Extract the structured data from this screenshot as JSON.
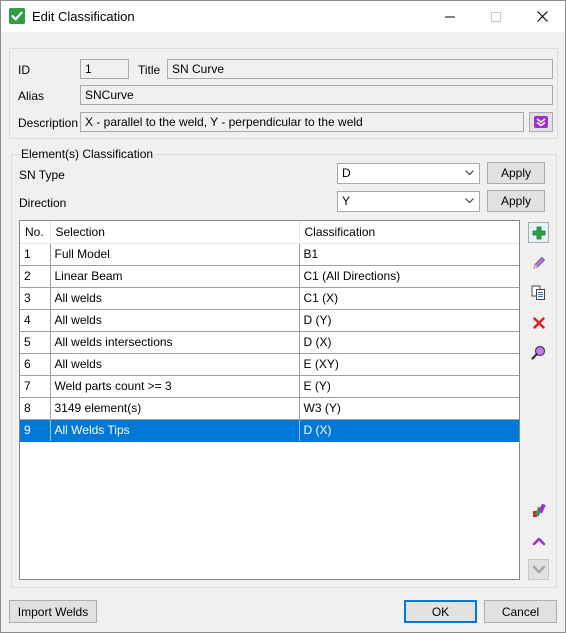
{
  "window": {
    "title": "Edit Classification"
  },
  "header": {
    "id_label": "ID",
    "id_value": "1",
    "title_label": "Title",
    "title_value": "SN Curve",
    "alias_label": "Alias",
    "alias_value": "SNCurve",
    "description_label": "Description",
    "description_value": "X - parallel to the weld, Y - perpendicular to the weld"
  },
  "classification": {
    "group_title": "Element(s) Classification",
    "sn_type_label": "SN Type",
    "sn_type_value": "D",
    "direction_label": "Direction",
    "direction_value": "Y",
    "apply_label": "Apply"
  },
  "table": {
    "columns": [
      "No.",
      "Selection",
      "Classification"
    ],
    "rows": [
      [
        "1",
        "Full Model",
        "B1"
      ],
      [
        "2",
        "Linear Beam",
        "C1 (All Directions)"
      ],
      [
        "3",
        "All welds",
        "C1 (X)"
      ],
      [
        "4",
        "All welds",
        "D (Y)"
      ],
      [
        "5",
        "All welds intersections",
        "D (X)"
      ],
      [
        "6",
        "All welds",
        "E (XY)"
      ],
      [
        "7",
        "Weld parts count >= 3",
        "E (Y)"
      ],
      [
        "8",
        "3149 element(s)",
        "W3 (Y)"
      ],
      [
        "9",
        "All Welds Tips",
        "D (X)"
      ]
    ],
    "selected_row": 9
  },
  "side_icons": [
    "add-icon",
    "edit-icon",
    "copy-icon",
    "delete-icon",
    "magnify-icon",
    "color-icon",
    "move-up-icon",
    "move-down-icon"
  ],
  "footer": {
    "import_label": "Import Welds",
    "ok_label": "OK",
    "cancel_label": "Cancel"
  },
  "colors": {
    "selection": "#0078d7",
    "accent_green": "#2ea043",
    "accent_purple": "#9b30d0",
    "delete_red": "#d92121"
  }
}
